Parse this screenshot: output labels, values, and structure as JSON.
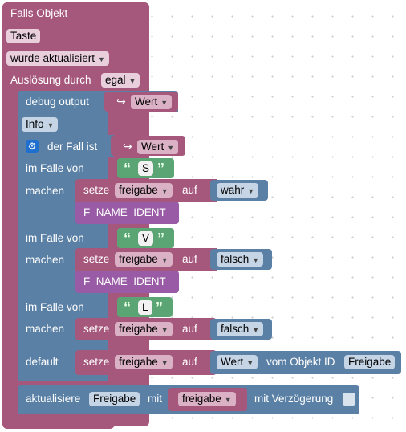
{
  "event": {
    "title": "Falls Objekt",
    "object_name": "Taste",
    "trigger_select": "wurde aktualisiert",
    "trigger_label": "Auslösung durch",
    "trigger_value": "egal"
  },
  "debug": {
    "label": "debug output",
    "value": "Wert",
    "level": "Info"
  },
  "switch": {
    "label": "der Fall ist",
    "value": "Wert",
    "cases": [
      {
        "case_label": "im Falle von",
        "case_value": "S",
        "do_label": "machen",
        "set_label": "setze",
        "var": "freigabe",
        "to_label": "auf",
        "val": "wahr",
        "extra": "F_NAME_IDENT"
      },
      {
        "case_label": "im Falle von",
        "case_value": "V",
        "do_label": "machen",
        "set_label": "setze",
        "var": "freigabe",
        "to_label": "auf",
        "val": "falsch",
        "extra": "F_NAME_IDENT"
      },
      {
        "case_label": "im Falle von",
        "case_value": "L",
        "do_label": "machen",
        "set_label": "setze",
        "var": "freigabe",
        "to_label": "auf",
        "val": "falsch"
      }
    ],
    "default": {
      "label": "default",
      "set_label": "setze",
      "var": "freigabe",
      "to_label": "auf",
      "val": "Wert",
      "from_label": "vom Objekt ID",
      "object_id": "Freigabe"
    }
  },
  "update": {
    "label": "aktualisiere",
    "object": "Freigabe",
    "with_label": "mit",
    "var": "freigabe",
    "delay_label": "mit Verzögerung"
  },
  "colors": {
    "event_block": "#a5577c",
    "logic_block": "#5b80a5",
    "text_block": "#5ba574",
    "function_block": "#995ba5"
  }
}
